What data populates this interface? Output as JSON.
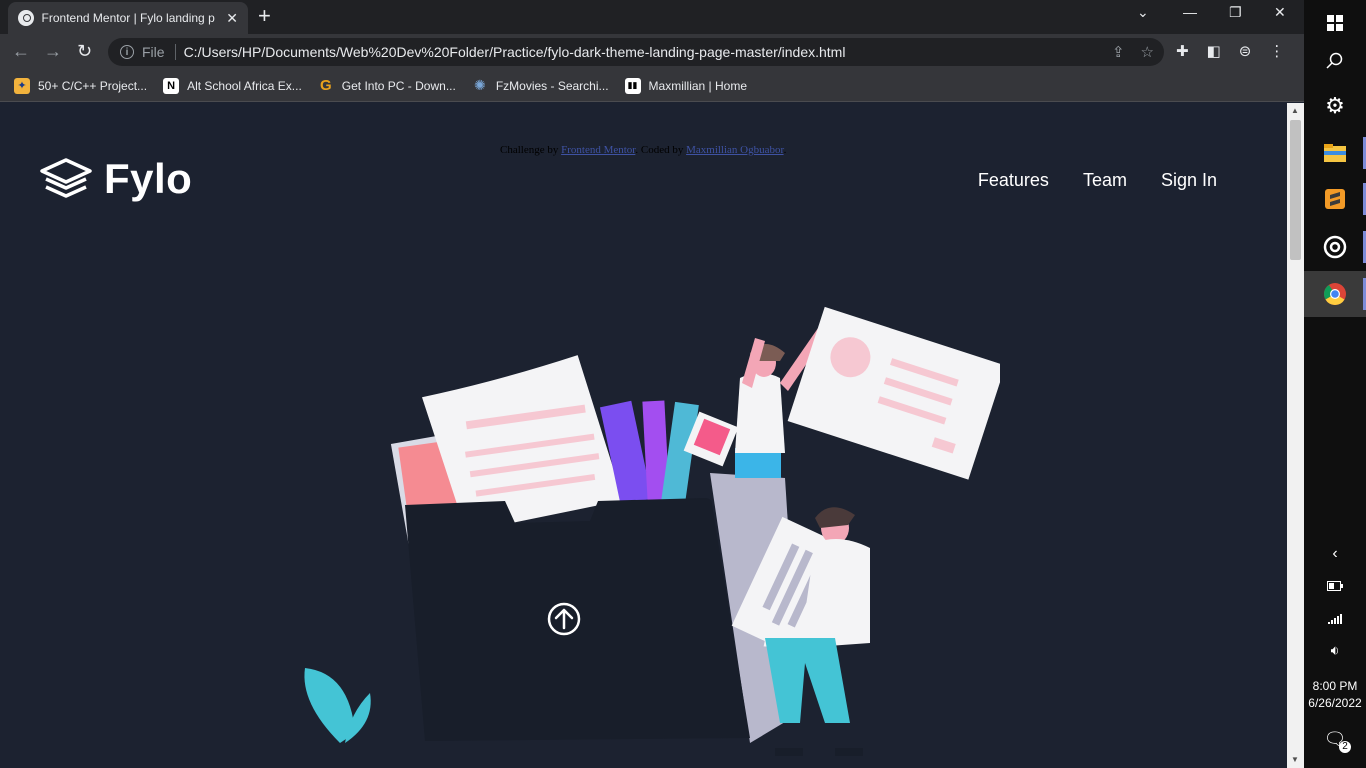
{
  "browser": {
    "tab_title": "Frontend Mentor | Fylo landing p",
    "tab_close": "✕",
    "new_tab": "+",
    "address_scheme": "File",
    "address_url": "C:/Users/HP/Documents/Web%20Dev%20Folder/Practice/fylo-dark-theme-landing-page-master/index.html",
    "bookmarks": [
      {
        "label": "50+ C/C++ Project...",
        "icon": "project-icon",
        "color": "#f2b33d"
      },
      {
        "label": "Alt School Africa Ex...",
        "icon": "notion-icon",
        "color": "#ffffff"
      },
      {
        "label": "Get Into PC - Down...",
        "icon": "getintopc-icon",
        "color": "#e9a21c"
      },
      {
        "label": "FzMovies - Searchi...",
        "icon": "fzmovies-icon",
        "color": "#7aa7d8"
      },
      {
        "label": "Maxmillian | Home",
        "icon": "maxmillian-icon",
        "color": "#ffffff"
      }
    ]
  },
  "page": {
    "logo_text": "Fylo",
    "attribution": {
      "prefix": "Challenge by",
      "challenge_link": "Frontend Mentor",
      "middle": ". Coded by",
      "author_link": "Maxmillian Ogbuabor",
      "suffix": "."
    },
    "nav": [
      "Features",
      "Team",
      "Sign In"
    ]
  },
  "taskbar": {
    "time": "8:00 PM",
    "date": "6/26/2022",
    "notifications": "2"
  },
  "colors": {
    "page_bg": "#1c2230",
    "folder": "#181e2a",
    "accent_cyan": "#44c4d5",
    "accent_pink": "#f3a6b6"
  }
}
